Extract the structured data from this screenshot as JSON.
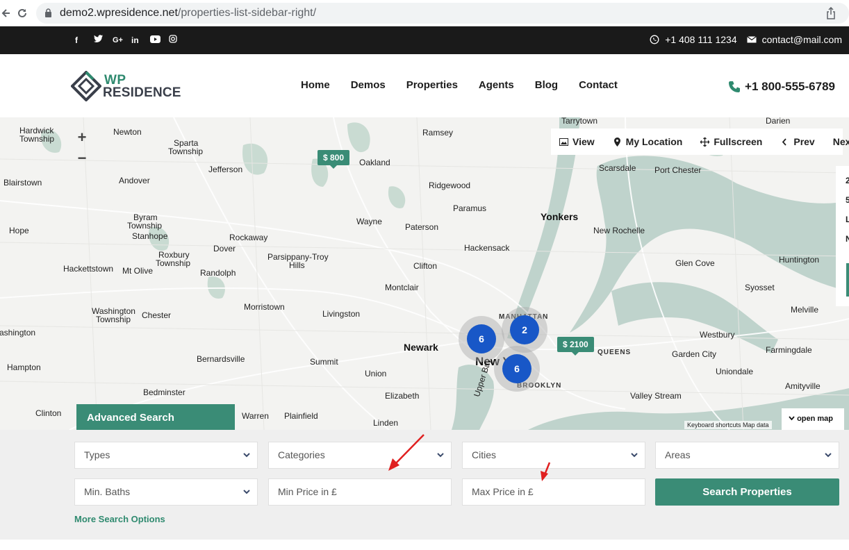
{
  "browser": {
    "url_domain": "demo2.wpresidence.net",
    "url_path": "/properties-list-sidebar-right/"
  },
  "topbar": {
    "social_icons": [
      "facebook-icon",
      "twitter-icon",
      "google-plus-icon",
      "linkedin-icon",
      "youtube-icon",
      "instagram-icon"
    ],
    "phone": "+1 408 111 1234",
    "email": "contact@mail.com"
  },
  "header": {
    "logo_top": "WP",
    "logo_bottom": "RESIDENCE",
    "menu": [
      "Home",
      "Demos",
      "Properties",
      "Agents",
      "Blog",
      "Contact"
    ],
    "phone": "+1 800-555-6789"
  },
  "map": {
    "zoom_in": "+",
    "zoom_out": "−",
    "controls": {
      "view": "View",
      "my_location": "My Location",
      "fullscreen": "Fullscreen",
      "prev": "Prev",
      "next": "Next"
    },
    "pins": {
      "pin1": "$ 800",
      "pin2": "$ 2100"
    },
    "clusters": {
      "c1": "6",
      "c2": "2",
      "c3": "6"
    },
    "places": {
      "tarrytown": "Tarrytown",
      "darien": "Darien",
      "hardwick": "Hardwick",
      "township": "Township",
      "newton": "Newton",
      "sparta": "Sparta",
      "sparta2": "Township",
      "jefferson": "Jefferson",
      "ramsey": "Ramsey",
      "oakland": "Oakland",
      "scarsdale": "Scarsdale",
      "portchester": "Port Chester",
      "blairstown": "Blairstown",
      "andover": "Andover",
      "ridgewood": "Ridgewood",
      "paramus": "Paramus",
      "yonkers": "Yonkers",
      "newrochelle": "New Rochelle",
      "byram": "Byram",
      "byram2": "Township",
      "stanhope": "Stanhope",
      "wayne": "Wayne",
      "paterson": "Paterson",
      "hope": "Hope",
      "rockaway": "Rockaway",
      "hackensack": "Hackensack",
      "roxbury": "Roxbury",
      "roxbury2": "Township",
      "dover": "Dover",
      "parsippany": "Parsippany-Troy",
      "hills": "Hills",
      "glencove": "Glen Cove",
      "huntington": "Huntington",
      "hackettstown": "Hackettstown",
      "mtolive": "Mt Olive",
      "randolph": "Randolph",
      "clifton": "Clifton",
      "montclair": "Montclair",
      "syosset": "Syosset",
      "morristown": "Morristown",
      "livingston": "Livingston",
      "manhattan": "MANHATTAN",
      "melville": "Melville",
      "washington": "Washington",
      "washington2": "Township",
      "chester": "Chester",
      "ashington": "ashington",
      "westbury": "Westbury",
      "farmingdale": "Farmingdale",
      "newark": "Newark",
      "newyork": "New York",
      "queens": "QUEENS",
      "gardencity": "Garden City",
      "hampton": "Hampton",
      "bernardsville": "Bernardsville",
      "summit": "Summit",
      "union": "Union",
      "uniondale": "Uniondale",
      "brooklyn": "BROOKLYN",
      "amityville": "Amityville",
      "bedminster": "Bedminster",
      "elizabeth": "Elizabeth",
      "valleystream": "Valley Stream",
      "upperbay": "Upper Bay",
      "clinton": "Clinton",
      "warren": "Warren",
      "plainfield": "Plainfield",
      "linden": "Linden"
    },
    "side_peek": [
      "2",
      "5",
      "L",
      "N"
    ],
    "open_map": "open map",
    "attribution": "Keyboard shortcuts    Map data"
  },
  "search": {
    "tab": "Advanced Search",
    "types": "Types",
    "categories": "Categories",
    "cities": "Cities",
    "areas": "Areas",
    "min_baths": "Min. Baths",
    "min_price": "Min Price in £",
    "max_price": "Max Price in £",
    "button": "Search Properties",
    "more": "More Search Options"
  },
  "colors": {
    "accent": "#3a8c76",
    "cluster": "#1857c7",
    "topbar": "#1a1a1a",
    "annotation_arrow": "#e02020"
  }
}
